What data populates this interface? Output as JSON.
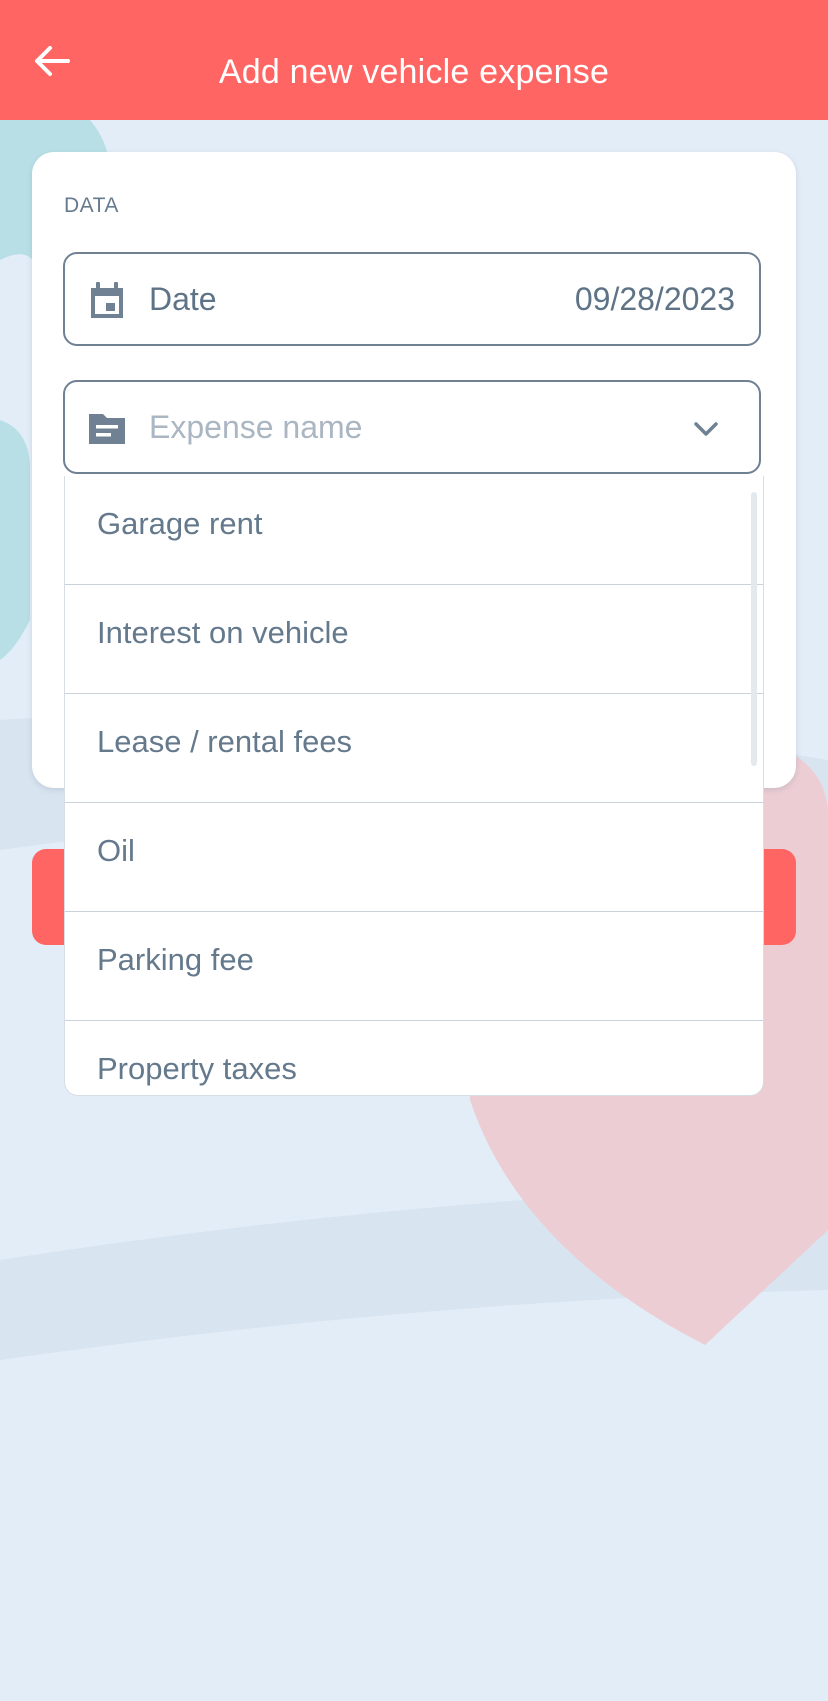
{
  "header": {
    "title": "Add new vehicle expense",
    "back_icon": "arrow-left-icon"
  },
  "form": {
    "section_label": "DATA",
    "date_field": {
      "icon": "calendar-icon",
      "label": "Date",
      "value": "09/28/2023"
    },
    "expense_field": {
      "icon": "folder-icon",
      "placeholder": "Expense name",
      "dropdown_icon": "chevron-down-icon"
    }
  },
  "dropdown": {
    "options": [
      "Garage rent",
      "Interest on vehicle",
      "Lease / rental fees",
      "Oil",
      "Parking fee",
      "Property taxes"
    ]
  },
  "colors": {
    "accent": "#ff6663",
    "text": "#5f7387",
    "background": "#e3edf7"
  }
}
